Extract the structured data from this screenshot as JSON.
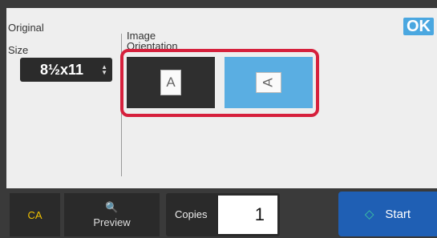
{
  "header": {
    "ok_label": "OK"
  },
  "original": {
    "title": "Original",
    "size_label": "Size",
    "size_value": "8½x11",
    "size_arrows": "▲\n▼"
  },
  "orientation": {
    "label_line1": "Image",
    "label_line2": "Orientation",
    "options": [
      {
        "glyph": "A",
        "selected": false
      },
      {
        "glyph": "A",
        "selected": true
      }
    ]
  },
  "footer": {
    "ca_label": "CA",
    "preview_icon": "🔍",
    "preview_label": "Preview",
    "copies_label": "Copies",
    "copies_value": "1",
    "start_icon": "◇",
    "start_label": "Start"
  },
  "colors": {
    "highlight": "#d6203c",
    "selected": "#5aaee2",
    "ok": "#4aa7e0",
    "start": "#1f5fb4",
    "ca_text": "#f0c000"
  }
}
